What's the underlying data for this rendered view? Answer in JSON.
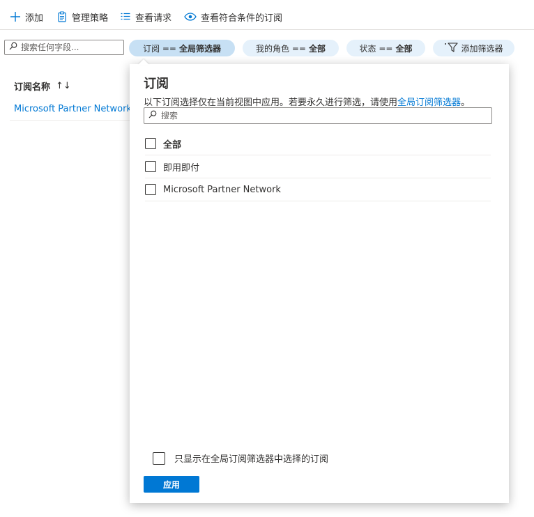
{
  "toolbar": {
    "add_label": "添加",
    "manage_policy_label": "管理策略",
    "view_requests_label": "查看请求",
    "view_eligible_label": "查看符合条件的订阅"
  },
  "filters": {
    "search_placeholder": "搜索任何字段...",
    "subscription_pill": {
      "key": "订阅 ==",
      "value": "全局筛选器"
    },
    "role_pill": {
      "key": "我的角色 ==",
      "value": "全部"
    },
    "status_pill": {
      "key": "状态 ==",
      "value": "全部"
    },
    "add_filter_label": "添加筛选器"
  },
  "table": {
    "column_header": "订阅名称",
    "sort_glyph": "↑↓",
    "rows": [
      {
        "name": "Microsoft Partner Network"
      }
    ]
  },
  "popup": {
    "title": "订阅",
    "description": "以下订阅选择仅在当前视图中应用。若要永久进行筛选，请使用",
    "description_link": "全局订阅筛选器",
    "description_end": "。",
    "search_placeholder": "搜索",
    "options": [
      {
        "label": "全部",
        "checked": false
      },
      {
        "label": "即用即付",
        "checked": false
      },
      {
        "label": "Microsoft Partner Network",
        "checked": false
      }
    ],
    "only_global_label": "只显示在全局订阅筛选器中选择的订阅",
    "only_global_checked": false,
    "apply_label": "应用"
  },
  "colors": {
    "accent": "#0078d4",
    "pill_bg": "#e5f1fb",
    "pill_active_bg": "#c7e0f4"
  },
  "icons": {
    "add": "plus-icon",
    "manage_policy": "clipboard-icon",
    "view_requests": "list-icon",
    "view_eligible": "eye-icon",
    "search": "search-icon",
    "add_filter": "filter-add-icon"
  }
}
